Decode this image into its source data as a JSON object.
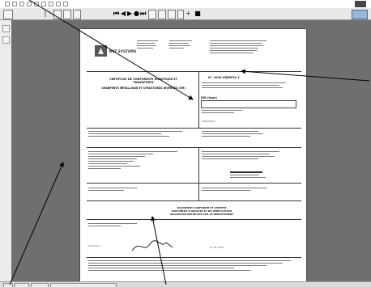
{
  "window": {
    "title": "",
    "min_label": ""
  },
  "toolbar": {
    "items": [
      "",
      "",
      "",
      "",
      ""
    ],
    "zoom_page_label": "",
    "icons": [
      "new-icon",
      "open-icon",
      "save-icon",
      "print-icon",
      "cut-icon",
      "copy-icon",
      "paste-icon",
      "undo-icon",
      "redo-icon",
      "first-page-icon",
      "prev-page-icon",
      "play-icon",
      "next-page-icon",
      "last-page-icon",
      "zoom-icon",
      "rotate-icon",
      "help-icon"
    ]
  },
  "document": {
    "brand": "BVT SYSTEMS",
    "title_line_1": "CERTIFICAT DE CONFORMITE ROBOTIQUE ET",
    "title_line_2": "TRANSPORTS",
    "subtitle": "CHARPENTE MÉTALLIQUE ET STRUCTURES DIVERSES (VM)",
    "certificate_no": "N°: 2024-CRN9F2L-1",
    "dw_label": "DW (type)",
    "dw_value": "DW000000",
    "center_line_1": "DOCUMENT CONFORME ET CERTIFIÉ",
    "center_line_2": "DOCUMENT D'ANALYSE ET DE VÉRIFICATION",
    "center_line_3": "VALIDATION DÉFINITIVE PAR LE DÉPARTEMENT",
    "signature_label": "Signature",
    "date_value": "01.01.2024"
  },
  "status": {
    "segments": [
      "",
      "",
      "",
      ""
    ]
  },
  "colors": {
    "viewport_bg": "#6f6f6f",
    "page_bg": "#ffffff",
    "toolbar_bg": "#e8e8e8"
  }
}
